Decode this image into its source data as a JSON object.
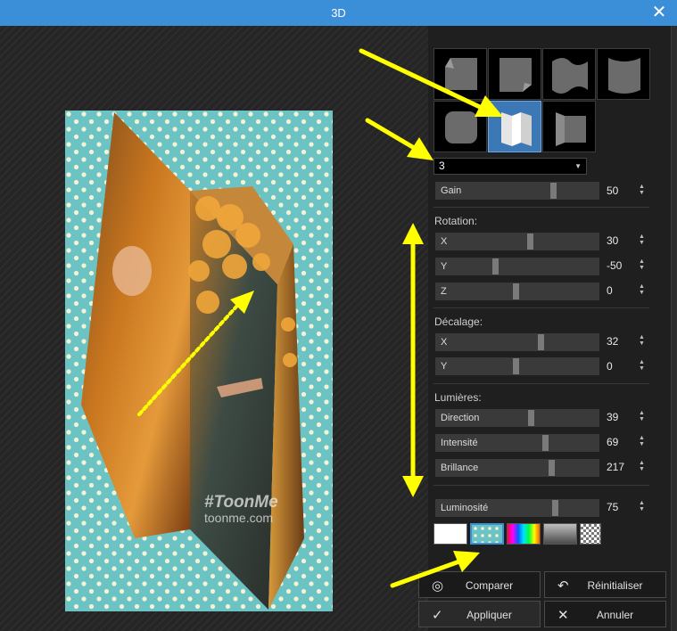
{
  "window": {
    "title": "3D",
    "close_glyph": "✕"
  },
  "preview": {
    "image_overlay_text": [
      "#ToonMe",
      "toonme.com"
    ],
    "background_color": "#6cc3c3"
  },
  "presets": {
    "selected_index": 5,
    "icons": [
      "page-curl-icon",
      "page-fold-icon",
      "wave-icon",
      "cylinder-icon",
      "pillow-icon",
      "folded-panels-icon",
      "panel-icon"
    ],
    "dropdown_value": "3"
  },
  "controls": {
    "gain": {
      "label": "Gain",
      "value": "50",
      "level": 0.73
    },
    "rotation": {
      "heading": "Rotation:",
      "x": {
        "label": "X",
        "value": "30",
        "level": 0.58
      },
      "y": {
        "label": "Y",
        "value": "-50",
        "level": 0.36
      },
      "z": {
        "label": "Z",
        "value": "0",
        "level": 0.49
      }
    },
    "offset": {
      "heading": "Décalage:",
      "x": {
        "label": "X",
        "value": "32",
        "level": 0.65
      },
      "y": {
        "label": "Y",
        "value": "0",
        "level": 0.49
      }
    },
    "lights": {
      "heading": "Lumières:",
      "direction": {
        "label": "Direction",
        "value": "39",
        "level": 0.59
      },
      "intensity": {
        "label": "Intensité",
        "value": "69",
        "level": 0.68
      },
      "brightness": {
        "label": "Brillance",
        "value": "217",
        "level": 0.72
      }
    },
    "luminosity": {
      "label": "Luminosité",
      "value": "75",
      "level": 0.74
    }
  },
  "swatches": {
    "items": [
      "white",
      "dots-teal",
      "rainbow",
      "gray-gradient",
      "checkerboard"
    ],
    "selected_index": 1
  },
  "buttons": {
    "compare": "Comparer",
    "reset": "Réinitialiser",
    "apply": "Appliquer",
    "cancel": "Annuler"
  },
  "colors": {
    "accent": "#3b8fd8",
    "annotation_arrow": "#ffff00",
    "panel_bg": "#1f1f1f",
    "slider_track": "#3a3a3a"
  }
}
